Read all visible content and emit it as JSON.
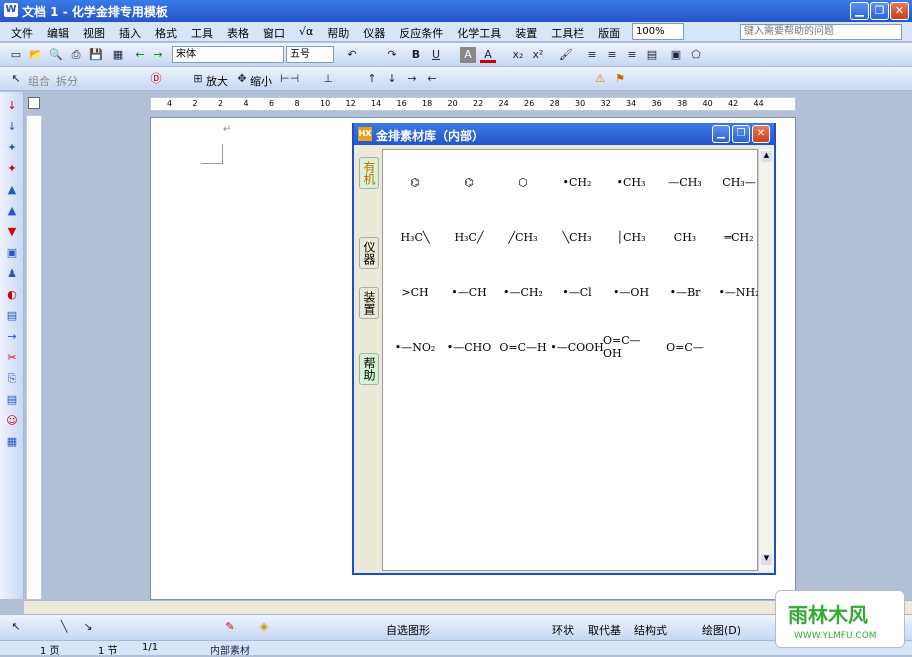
{
  "window": {
    "title": "文档 1 - 化学金排专用模板",
    "min": "▁",
    "restore": "❐",
    "close": "✕"
  },
  "menu": [
    "文件",
    "编辑",
    "视图",
    "插入",
    "格式",
    "工具",
    "表格",
    "窗口",
    "√α",
    "帮助",
    "仪器",
    "反应条件",
    "化学工具",
    "装置",
    "工具栏",
    "版面"
  ],
  "zoom": "100%",
  "help_placeholder": "键入需要帮助的问题",
  "font": {
    "name": "宋体",
    "size": "五号"
  },
  "tb2": [
    "组合",
    "拆分",
    "放大",
    "缩小"
  ],
  "ruler_labels": [
    "4",
    "2",
    "2",
    "4",
    "6",
    "8",
    "10",
    "12",
    "14",
    "16",
    "18",
    "20",
    "22",
    "24",
    "26",
    "28",
    "30",
    "32",
    "34",
    "36",
    "38",
    "40",
    "42",
    "44"
  ],
  "dialog": {
    "title": "金排素材库（内部）",
    "hx": "HX",
    "tabs": [
      "有机",
      "仪器",
      "装置",
      "帮助"
    ]
  },
  "palette": [
    [
      "⌬",
      "⌬",
      "⬡",
      "•CH₂",
      "•CH₃",
      "—CH₃",
      "CH₃—"
    ],
    [
      "H₃C╲",
      "H₃C╱",
      "╱CH₃",
      "╲CH₃",
      "│CH₃",
      "CH₃",
      "═CH₂"
    ],
    [
      ">CH",
      "•—CH",
      "•—CH₂",
      "•—Cl",
      "•—OH",
      "•—Br",
      "•—NH₂"
    ],
    [
      "•—NO₂",
      "•—CHO",
      "O=C—H",
      "•—COOH",
      "O=C—OH",
      "O=C—",
      ""
    ]
  ],
  "drawbar": {
    "autoshape": "自选图形",
    "ring": "环状",
    "subst": "取代基",
    "formula": "结构式",
    "draw": "绘图(D)"
  },
  "status": {
    "page": "1 页",
    "section": "1 节",
    "pos": "1/1",
    "pane": "内部素材"
  },
  "logo": {
    "text": "雨林木风",
    "url": "WWW.YLMFU.COM"
  }
}
